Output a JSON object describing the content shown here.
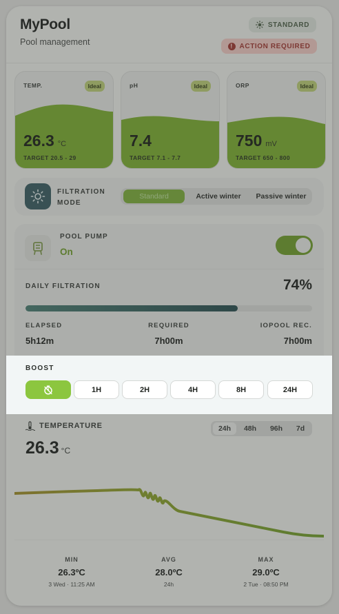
{
  "header": {
    "title": "MyPool",
    "subtitle": "Pool management",
    "mode_badge": "STANDARD",
    "action_badge": "ACTION REQUIRED"
  },
  "metrics": [
    {
      "label": "TEMP.",
      "status": "Ideal",
      "value": "26.3",
      "unit": "°C",
      "target": "TARGET 20.5 - 29"
    },
    {
      "label": "pH",
      "status": "Ideal",
      "value": "7.4",
      "unit": "",
      "target": "TARGET 7.1 - 7.7"
    },
    {
      "label": "ORP",
      "status": "Ideal",
      "value": "750",
      "unit": "mV",
      "target": "TARGET 650 - 800"
    }
  ],
  "filtration": {
    "label": "FILTRATION MODE",
    "options": [
      "Standard",
      "Active winter",
      "Passive winter"
    ],
    "selected": "Standard"
  },
  "pump": {
    "label": "POOL PUMP",
    "status": "On",
    "toggle_on": true
  },
  "daily": {
    "label": "DAILY FILTRATION",
    "percent": "74%",
    "progress": 0.74,
    "stats": [
      {
        "label": "ELAPSED",
        "value": "5h12m"
      },
      {
        "label": "REQUIRED",
        "value": "7h00m"
      },
      {
        "label": "IOPOOL REC.",
        "value": "7h00m"
      }
    ]
  },
  "boost": {
    "label": "BOOST",
    "options": [
      "1H",
      "2H",
      "4H",
      "8H",
      "24H"
    ],
    "active_icon": "timer-off-icon"
  },
  "temperature": {
    "label": "TEMPERATURE",
    "value": "26.3",
    "unit": "°C",
    "ranges": [
      "24h",
      "48h",
      "96h",
      "7d"
    ],
    "selected_range": "24h",
    "min": {
      "label": "MIN",
      "value": "26.3ºC",
      "sub": "3 Wed · 11:25 AM"
    },
    "avg": {
      "label": "AVG",
      "value": "28.0ºC",
      "sub": "24h"
    },
    "max": {
      "label": "MAX",
      "value": "29.0ºC",
      "sub": "2 Tue · 08:50 PM"
    }
  },
  "colors": {
    "accent": "#8cc63f",
    "pump_on": "#5f8a1f",
    "alert": "#8d2a25",
    "progress": "#1c3f41"
  }
}
